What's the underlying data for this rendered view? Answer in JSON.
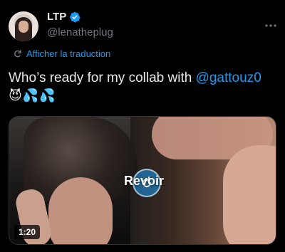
{
  "tweet": {
    "display_name": "LTP",
    "handle": "@lenatheplug",
    "verified": true,
    "translate_label": "Afficher la traduction",
    "text_before": "Who’s ready for my collab with ",
    "mention": "@gattouz0",
    "emojis": "😈💦💦"
  },
  "media": {
    "replay_label": "Revoir",
    "duration": "1:20"
  },
  "icons": {
    "verified": "verified-badge-icon",
    "more": "more-options-icon",
    "translate": "translate-icon",
    "replay": "replay-icon"
  },
  "colors": {
    "accent": "#1d9bf0",
    "text": "#e7e9ea",
    "muted": "#71767b",
    "background": "#000000"
  }
}
